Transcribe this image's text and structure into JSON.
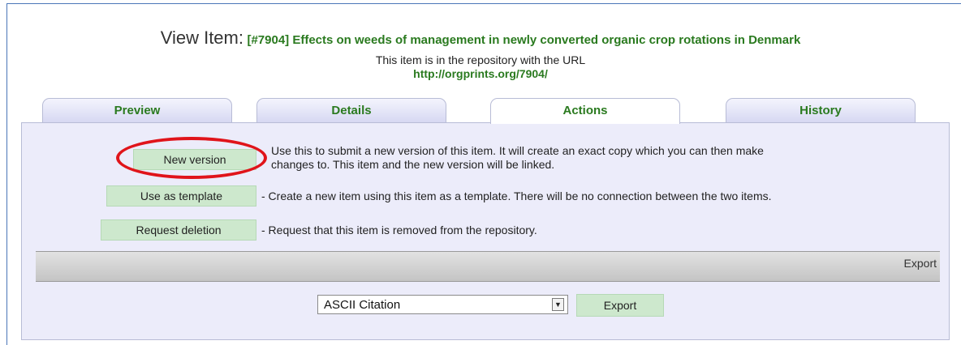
{
  "header": {
    "title_prefix": "View Item:",
    "item_title": "[#7904] Effects on weeds of management in newly converted organic crop rotations in Denmark",
    "url_intro": "This item is in the repository with the URL",
    "url": "http://orgprints.org/7904/"
  },
  "tabs": [
    {
      "label": "Preview",
      "active": false
    },
    {
      "label": "Details",
      "active": false
    },
    {
      "label": "Actions",
      "active": true
    },
    {
      "label": "History",
      "active": false
    }
  ],
  "actions": {
    "new_version": {
      "label": "New version",
      "line1": "Use this to submit a new version of this item. It will create an exact copy which you can then make",
      "line2": "changes to. This item and the new version will be linked."
    },
    "use_as_template": {
      "label": "Use as template",
      "desc": "- Create a new item using this item as a template. There will be no connection between the two items."
    },
    "request_deletion": {
      "label": "Request deletion",
      "desc": "- Request that this item is removed from the repository."
    }
  },
  "export": {
    "bar_label": "Export",
    "format_selected": "ASCII Citation",
    "button_label": "Export"
  },
  "colors": {
    "title_green": "#2a7a1f",
    "button_green": "#cde8cd",
    "panel_bg": "#ececfa",
    "highlight_red": "#e0141a"
  }
}
